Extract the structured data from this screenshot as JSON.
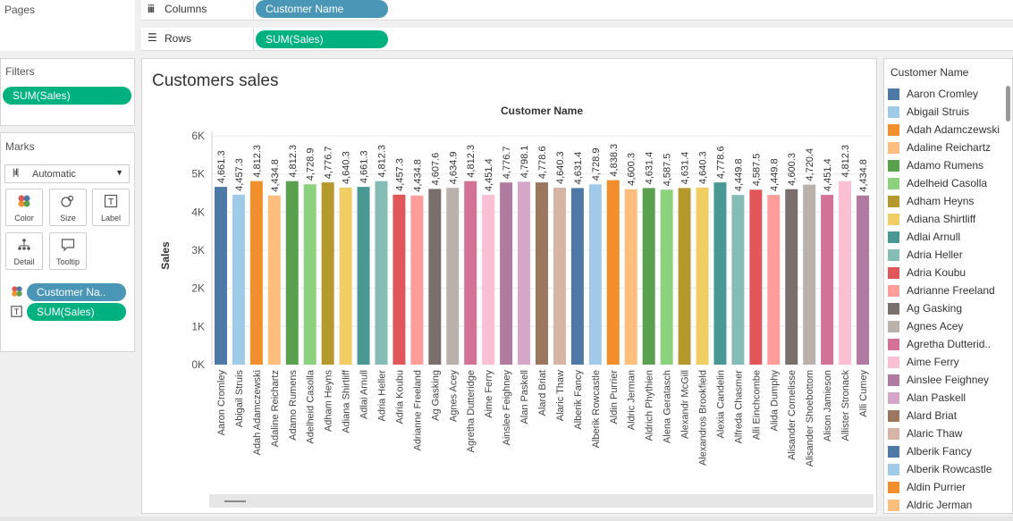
{
  "shelves": {
    "pages_label": "Pages",
    "columns_label": "Columns",
    "columns_pill": "Customer Name",
    "rows_label": "Rows",
    "rows_pill": "SUM(Sales)"
  },
  "filters": {
    "title": "Filters",
    "pill": "SUM(Sales)"
  },
  "marks": {
    "title": "Marks",
    "type": "Automatic",
    "buttons": {
      "color": "Color",
      "size": "Size",
      "label": "Label",
      "detail": "Detail",
      "tooltip": "Tooltip"
    },
    "fields": [
      {
        "icon": "color-icon",
        "label": "Customer Na.."
      },
      {
        "icon": "label-icon",
        "label": "SUM(Sales)"
      }
    ]
  },
  "worksheet": {
    "title": "Customers sales"
  },
  "chart_data": {
    "type": "bar",
    "column_header": "Customer Name",
    "ylabel": "Sales",
    "ylim": [
      0,
      6000
    ],
    "yticks": [
      "0K",
      "1K",
      "2K",
      "3K",
      "4K",
      "5K",
      "6K"
    ],
    "categories": [
      "Aaron Cromley",
      "Abigail Struis",
      "Adah Adamczewski",
      "Adaline Reichartz",
      "Adamo Rumens",
      "Adelheid Casolla",
      "Adham Heyns",
      "Adiana Shirtliff",
      "Adlai Arnull",
      "Adria Heller",
      "Adria Koubu",
      "Adrianne Freeland",
      "Ag Gasking",
      "Agnes Acey",
      "Agretha Dutteridge",
      "Aime Ferry",
      "Ainslee Feighney",
      "Alan Paskell",
      "Alard Briat",
      "Alaric Thaw",
      "Alberik Fancy",
      "Alberik Rowcastle",
      "Aldin Purrier",
      "Aldric Jerman",
      "Aldrich Phythien",
      "Alena Geratasch",
      "Alexandr McGill",
      "Alexandros Brookfield",
      "Alexia Candelin",
      "Alfreda Chasmer",
      "Alli Einchcombe",
      "Alida Dumphy",
      "Alisander Cornelisse",
      "Alisander Shoebottom",
      "Alison Jamieson",
      "Allister Stronack",
      "Alli Cumey"
    ],
    "values": [
      4661.3,
      4457.3,
      4812.3,
      4434.8,
      4812.3,
      4728.9,
      4776.7,
      4640.3,
      4661.3,
      4812.3,
      4457.3,
      4434.8,
      4607.6,
      4634.9,
      4812.3,
      4451.4,
      4776.7,
      4798.1,
      4778.6,
      4640.3,
      4631.4,
      4728.9,
      4838.3,
      4600.3,
      4631.4,
      4587.5,
      4631.4,
      4640.3,
      4778.6,
      4449.8,
      4587.5,
      4449.8,
      4600.3,
      4720.4,
      4451.4,
      4812.3,
      4434.8
    ],
    "data_labels": [
      "4,661.3",
      "4,457.3",
      "4,812.3",
      "4,434.8",
      "4,812.3",
      "4,728.9",
      "4,776.7",
      "4,640.3",
      "4,661.3",
      "4,812.3",
      "4,457.3",
      "4,434.8",
      "4,607.6",
      "4,634.9",
      "4,812.3",
      "4,451.4",
      "4,776.7",
      "4,798.1",
      "4,778.6",
      "4,640.3",
      "4,631.4",
      "4,728.9",
      "4,838.3",
      "4,600.3",
      "4,631.4",
      "4,587.5",
      "4,631.4",
      "4,640.3",
      "4,778.6",
      "4,449.8",
      "4,587.5",
      "4,449.8",
      "4,600.3",
      "4,720.4",
      "4,451.4",
      "4,812.3",
      "4,434.8"
    ],
    "colors": [
      "#4e79a7",
      "#a0cbe8",
      "#f28e2b",
      "#ffbe7d",
      "#59a14f",
      "#8cd17d",
      "#b6992d",
      "#f1ce63",
      "#499894",
      "#86bcb6",
      "#e15759",
      "#ff9d9a",
      "#79706e",
      "#bab0ac",
      "#d37295",
      "#fabfd2",
      "#b07aa1",
      "#d4a6c8",
      "#9d7660",
      "#d7b5a6",
      "#4e79a7",
      "#a0cbe8",
      "#f28e2b",
      "#ffbe7d",
      "#59a14f",
      "#8cd17d",
      "#b6992d",
      "#f1ce63",
      "#499894",
      "#86bcb6",
      "#e15759",
      "#ff9d9a",
      "#79706e",
      "#bab0ac",
      "#d37295",
      "#fabfd2",
      "#b07aa1",
      "#d4a6c8"
    ],
    "grid": true,
    "legend": "right"
  },
  "legend": {
    "title": "Customer Name",
    "items": [
      {
        "label": "Aaron Cromley",
        "color": "#4e79a7"
      },
      {
        "label": "Abigail Struis",
        "color": "#a0cbe8"
      },
      {
        "label": "Adah Adamczewski",
        "color": "#f28e2b"
      },
      {
        "label": "Adaline Reichartz",
        "color": "#ffbe7d"
      },
      {
        "label": "Adamo Rumens",
        "color": "#59a14f"
      },
      {
        "label": "Adelheid Casolla",
        "color": "#8cd17d"
      },
      {
        "label": "Adham Heyns",
        "color": "#b6992d"
      },
      {
        "label": "Adiana Shirtliff",
        "color": "#f1ce63"
      },
      {
        "label": "Adlai Arnull",
        "color": "#499894"
      },
      {
        "label": "Adria Heller",
        "color": "#86bcb6"
      },
      {
        "label": "Adria Koubu",
        "color": "#e15759"
      },
      {
        "label": "Adrianne Freeland",
        "color": "#ff9d9a"
      },
      {
        "label": "Ag Gasking",
        "color": "#79706e"
      },
      {
        "label": "Agnes Acey",
        "color": "#bab0ac"
      },
      {
        "label": "Agretha Dutterid..",
        "color": "#d37295"
      },
      {
        "label": "Aime Ferry",
        "color": "#fabfd2"
      },
      {
        "label": "Ainslee Feighney",
        "color": "#b07aa1"
      },
      {
        "label": "Alan Paskell",
        "color": "#d4a6c8"
      },
      {
        "label": "Alard Briat",
        "color": "#9d7660"
      },
      {
        "label": "Alaric Thaw",
        "color": "#d7b5a6"
      },
      {
        "label": "Alberik Fancy",
        "color": "#4e79a7"
      },
      {
        "label": "Alberik Rowcastle",
        "color": "#a0cbe8"
      },
      {
        "label": "Aldin Purrier",
        "color": "#f28e2b"
      },
      {
        "label": "Aldric Jerman",
        "color": "#ffbe7d"
      }
    ]
  }
}
